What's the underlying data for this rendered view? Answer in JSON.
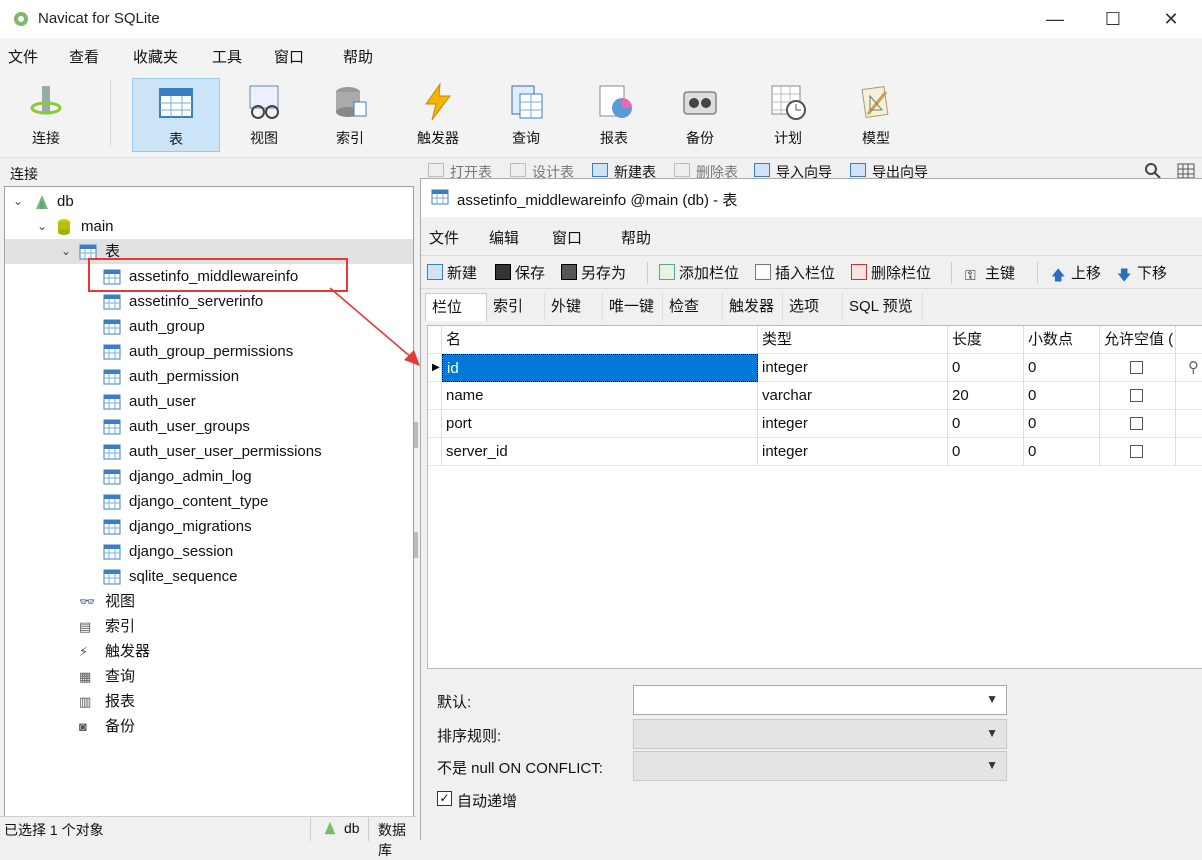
{
  "app": {
    "title": "Navicat for SQLite"
  },
  "menu": [
    "文件",
    "查看",
    "收藏夹",
    "工具",
    "窗口",
    "帮助"
  ],
  "ribbon": [
    {
      "label": "连接",
      "icon": "plug-icon"
    },
    {
      "label": "表",
      "icon": "table-icon"
    },
    {
      "label": "视图",
      "icon": "view-glasses-icon"
    },
    {
      "label": "索引",
      "icon": "index-icon"
    },
    {
      "label": "触发器",
      "icon": "lightning-icon"
    },
    {
      "label": "查询",
      "icon": "query-icon"
    },
    {
      "label": "报表",
      "icon": "report-icon"
    },
    {
      "label": "备份",
      "icon": "backup-icon"
    },
    {
      "label": "计划",
      "icon": "schedule-icon"
    },
    {
      "label": "模型",
      "icon": "model-icon"
    }
  ],
  "left": {
    "header": "连接",
    "db": "db",
    "schema": "main",
    "tables_group": "表",
    "tables": [
      "assetinfo_middlewareinfo",
      "assetinfo_serverinfo",
      "auth_group",
      "auth_group_permissions",
      "auth_permission",
      "auth_user",
      "auth_user_groups",
      "auth_user_user_permissions",
      "django_admin_log",
      "django_content_type",
      "django_migrations",
      "django_session",
      "sqlite_sequence"
    ],
    "groups": [
      "视图",
      "索引",
      "触发器",
      "查询",
      "报表",
      "备份"
    ]
  },
  "object_toolbar": [
    "打开表",
    "设计表",
    "新建表",
    "删除表",
    "导入向导",
    "导出向导"
  ],
  "inner": {
    "title": "assetinfo_middlewareinfo @main (db) - 表",
    "menu": [
      "文件",
      "编辑",
      "窗口",
      "帮助"
    ],
    "toolbar": [
      "新建",
      "保存",
      "另存为",
      "添加栏位",
      "插入栏位",
      "删除栏位",
      "主键",
      "上移",
      "下移"
    ],
    "tabs": [
      "栏位",
      "索引",
      "外键",
      "唯一键",
      "检查",
      "触发器",
      "选项",
      "SQL 预览"
    ],
    "grid": {
      "columns": [
        "名",
        "类型",
        "长度",
        "小数点",
        "允许空值 ("
      ],
      "rows": [
        {
          "name": "id",
          "type": "integer",
          "length": "0",
          "decimals": "0"
        },
        {
          "name": "name",
          "type": "varchar",
          "length": "20",
          "decimals": "0"
        },
        {
          "name": "port",
          "type": "integer",
          "length": "0",
          "decimals": "0"
        },
        {
          "name": "server_id",
          "type": "integer",
          "length": "0",
          "decimals": "0"
        }
      ]
    },
    "props": {
      "default_label": "默认:",
      "collation_label": "排序规则:",
      "conflict_label": "不是 null ON CONFLICT:",
      "autoinc_label": "自动递增"
    }
  },
  "status": {
    "left": "已选择 1 个对象",
    "db": "db",
    "db_label": "数据库"
  }
}
